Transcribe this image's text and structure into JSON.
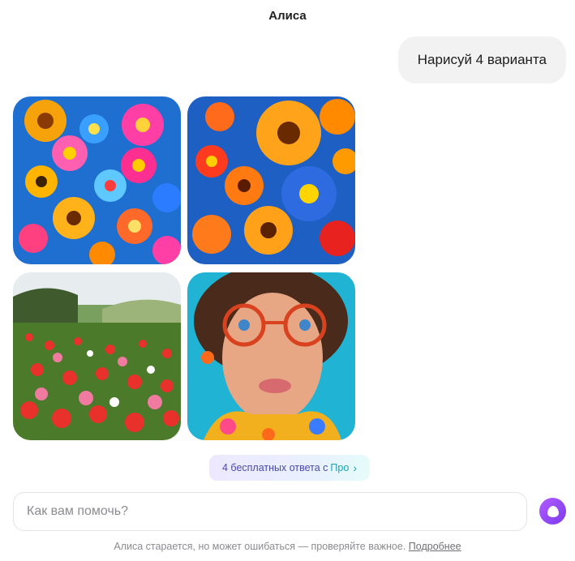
{
  "header": {
    "title": "Алиса"
  },
  "chat": {
    "user_message": "Нарисуй 4 варианта"
  },
  "promo": {
    "text": "4 бесплатных ответа с",
    "pro": "Про",
    "chevron": "›"
  },
  "composer": {
    "placeholder": "Как вам помочь?"
  },
  "footer": {
    "disclaimer": "Алиса старается, но может ошибаться — проверяйте важное.",
    "link": "Подробнее"
  },
  "colors": {
    "accent": "#8a3ffc",
    "promo_pro": "#17a3b6"
  }
}
